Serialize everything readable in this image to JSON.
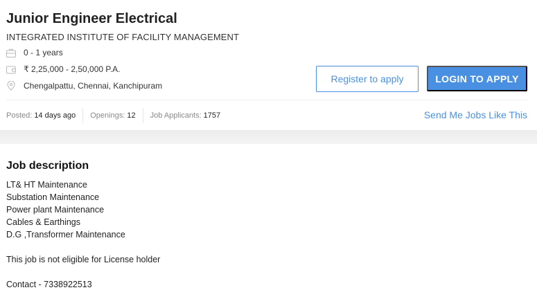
{
  "job": {
    "title": "Junior Engineer Electrical",
    "company": "INTEGRATED INSTITUTE OF FACILITY MANAGEMENT",
    "experience": "0 - 1 years",
    "salary": "₹ 2,25,000 - 2,50,000 P.A.",
    "location": "Chengalpattu, Chennai, Kanchipuram"
  },
  "actions": {
    "register_label": "Register to apply",
    "login_label": "LOGIN TO APPLY",
    "send_jobs_label": "Send Me Jobs Like This"
  },
  "stats": {
    "posted_label": "Posted:",
    "posted_value": "14 days ago",
    "openings_label": "Openings:",
    "openings_value": "12",
    "applicants_label": "Job Applicants:",
    "applicants_value": "1757"
  },
  "description": {
    "heading": "Job description",
    "lines": [
      "LT& HT Maintenance",
      "Substation Maintenance",
      "Power plant Maintenance",
      "Cables & Earthings",
      "D.G ,Transformer Maintenance"
    ],
    "eligibility": "This job is not eligible for License holder",
    "contact": "Contact - 7338922513"
  },
  "icons": {
    "experience": "briefcase-icon",
    "salary": "wallet-icon",
    "location": "location-pin-icon"
  },
  "colors": {
    "accent": "#4a90e2",
    "icon_gray": "#b8b8b8",
    "band": "#efefef"
  }
}
